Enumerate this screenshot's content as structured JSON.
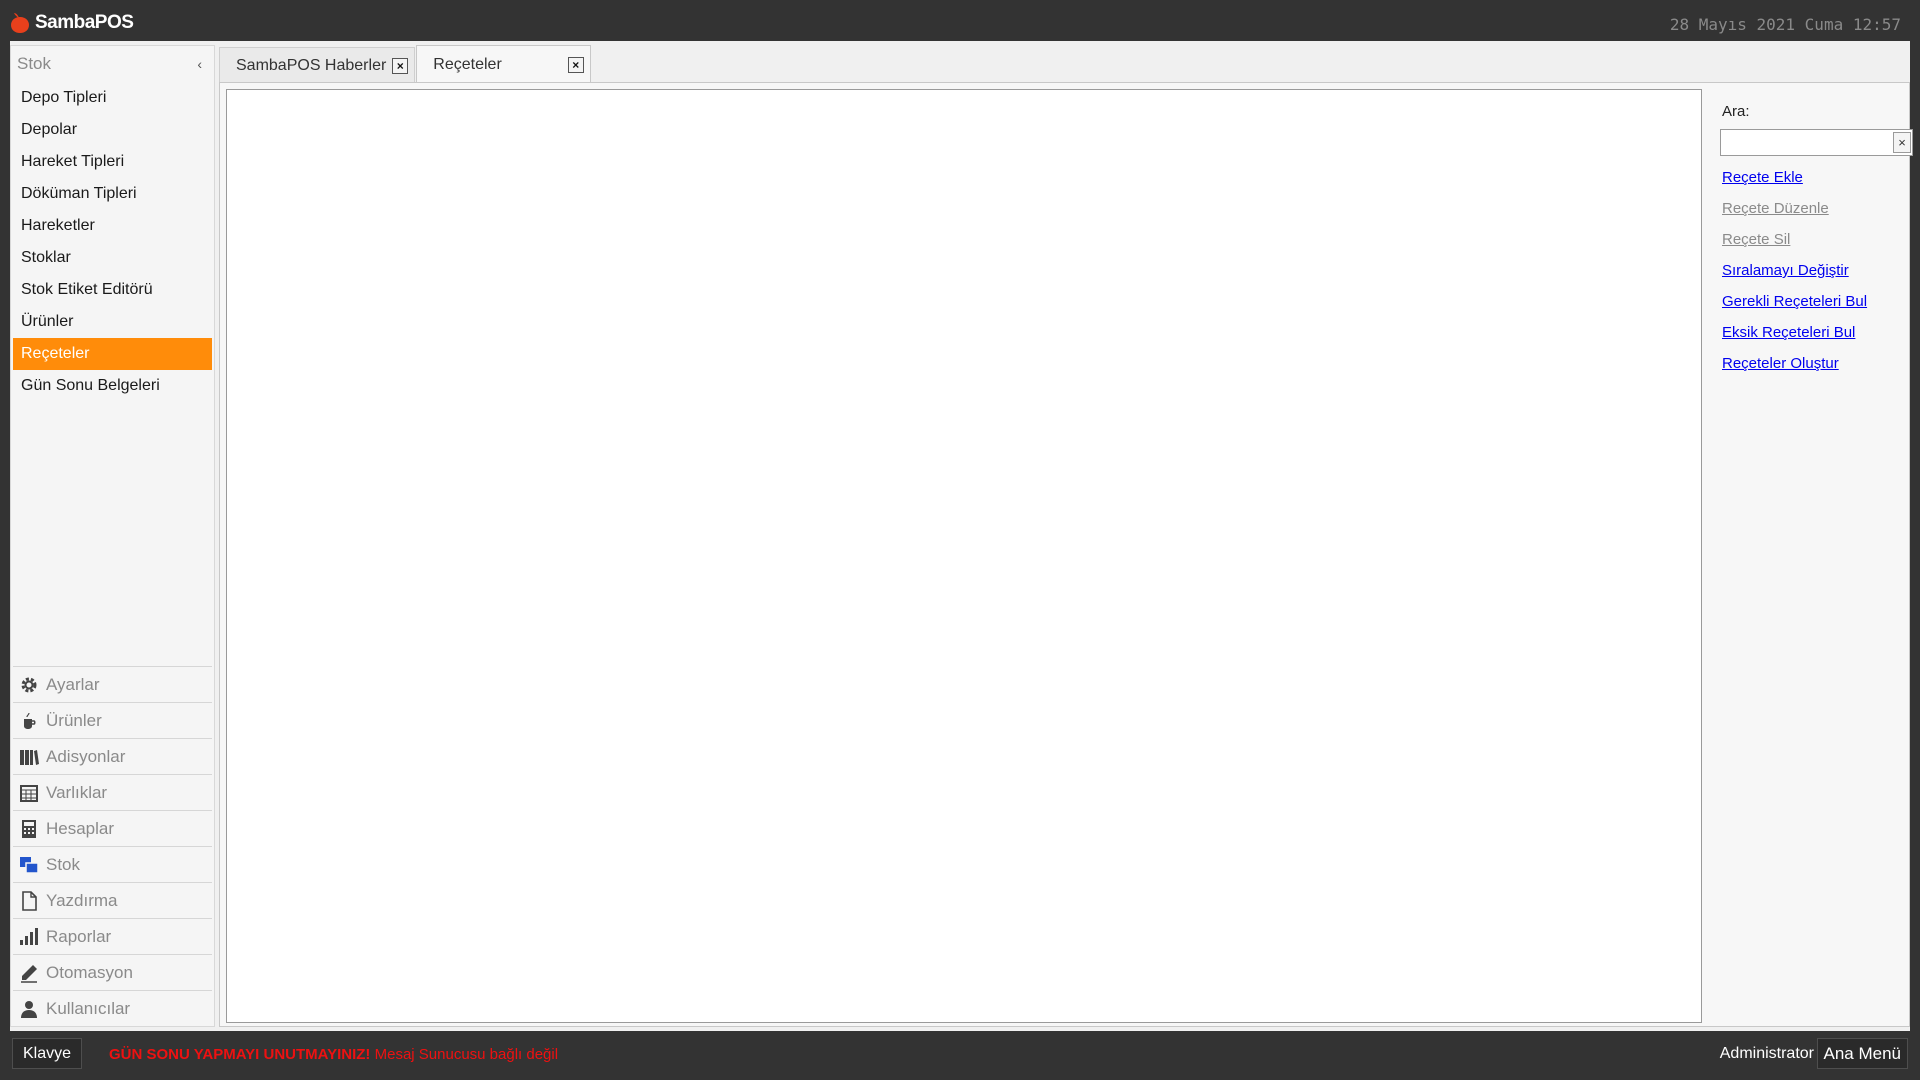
{
  "app": {
    "logo_text": "SambaPOS",
    "clock": "28 Mayıs 2021 Cuma 12:57"
  },
  "sidebar": {
    "header": "Stok",
    "collapse_glyph": "‹",
    "items": [
      {
        "label": "Depo Tipleri"
      },
      {
        "label": "Depolar"
      },
      {
        "label": "Hareket Tipleri"
      },
      {
        "label": "Döküman Tipleri"
      },
      {
        "label": "Hareketler"
      },
      {
        "label": "Stoklar"
      },
      {
        "label": "Stok Etiket Editörü"
      },
      {
        "label": "Ürünler"
      },
      {
        "label": "Reçeteler",
        "active": true
      },
      {
        "label": "Gün Sonu Belgeleri"
      }
    ],
    "nav": [
      {
        "label": "Ayarlar",
        "icon": "gear-icon"
      },
      {
        "label": "Ürünler",
        "icon": "coffee-cup-icon"
      },
      {
        "label": "Adisyonlar",
        "icon": "books-icon"
      },
      {
        "label": "Varlıklar",
        "icon": "grid-table-icon"
      },
      {
        "label": "Hesaplar",
        "icon": "calculator-icon"
      },
      {
        "label": "Stok",
        "icon": "stock-boxes-icon"
      },
      {
        "label": "Yazdırma",
        "icon": "document-icon"
      },
      {
        "label": "Raporlar",
        "icon": "bar-chart-icon"
      },
      {
        "label": "Otomasyon",
        "icon": "pen-icon"
      },
      {
        "label": "Kullanıcılar",
        "icon": "user-icon"
      }
    ]
  },
  "tabs": [
    {
      "label": "SambaPOS Haberler",
      "close": "×"
    },
    {
      "label": "Reçeteler",
      "close": "×",
      "active": true
    }
  ],
  "right_panel": {
    "search_label": "Ara:",
    "search_value": "",
    "clear_glyph": "×",
    "actions": [
      {
        "label": "Reçete Ekle",
        "enabled": true
      },
      {
        "label": "Reçete Düzenle",
        "enabled": false
      },
      {
        "label": "Reçete Sil",
        "enabled": false
      },
      {
        "label": "Sıralamayı Değiştir",
        "enabled": true
      },
      {
        "label": "Gerekli Reçeteleri Bul",
        "enabled": true
      },
      {
        "label": "Eksik Reçeteleri Bul",
        "enabled": true
      },
      {
        "label": "Reçeteler Oluştur",
        "enabled": true
      }
    ]
  },
  "statusbar": {
    "keyboard_label": "Klavye",
    "warning": "GÜN SONU YAPMAYI UNUTMAYINIZ!",
    "message": "Mesaj Sunucusu bağlı değil",
    "user": "Administrator",
    "main_menu_label": "Ana Menü"
  },
  "colors": {
    "accent": "#ff8c0a",
    "warning": "#ee1111",
    "link": "#0000ee",
    "disabled": "#8a8a8a",
    "stock_icon": "#2255cc"
  }
}
